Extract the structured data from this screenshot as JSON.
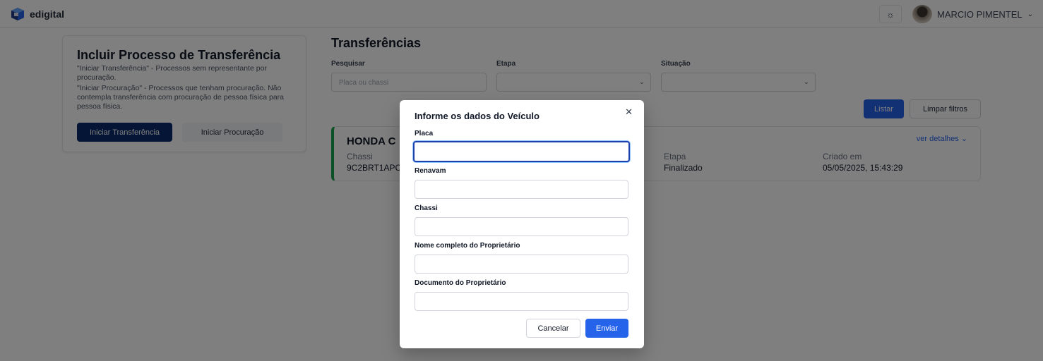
{
  "app": {
    "brand": "edigital"
  },
  "header": {
    "theme_icon": "☼",
    "user_name": "MARCIO PIMENTEL",
    "user_chevron": "⌄"
  },
  "left_card": {
    "title": "Incluir Processo de Transferência",
    "desc_1": "\"Iniciar Transferência\" - Processos sem representante por procuração.",
    "desc_2": "\"Iniciar Procuração\" - Processos que tenham procuração. Não contempla transferência com procuração de pessoa física para pessoa física.",
    "btn_transfer": "Iniciar Transferência",
    "btn_procuracao": "Iniciar Procuração"
  },
  "transfers": {
    "title": "Transferências",
    "filters": {
      "search_label": "Pesquisar",
      "search_placeholder": "Placa ou chassi",
      "stage_label": "Etapa",
      "status_label": "Situação"
    },
    "list_button": "Listar",
    "clear_button": "Limpar filtros",
    "result": {
      "title": "HONDA C",
      "details_link": "ver detalhes ⌄",
      "chassi_label": "Chassi",
      "chassi_value": "9C2BRT1APC",
      "stage_label": "Etapa",
      "stage_value": "Finalizado",
      "created_label": "Criado em",
      "created_value": "05/05/2025, 15:43:29"
    }
  },
  "modal": {
    "title": "Informe os dados do Veículo",
    "close_icon": "✕",
    "fields": {
      "placa": "Placa",
      "renavam": "Renavam",
      "chassi": "Chassi",
      "owner_name": "Nome completo do Proprietário",
      "owner_doc": "Documento do Proprietário"
    },
    "cancel": "Cancelar",
    "submit": "Enviar"
  },
  "colors": {
    "primary": "#2563eb",
    "primary_dark": "#0b2a6b",
    "success_accent": "#16a34a"
  }
}
